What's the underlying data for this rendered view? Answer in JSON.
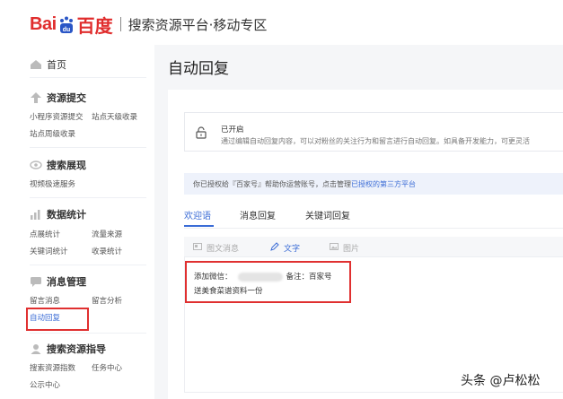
{
  "header": {
    "logo_bai": "Bai",
    "logo_paw": "du",
    "logo_du": "百度",
    "platform": "搜索资源平台·移动专区"
  },
  "sidebar": {
    "home": "首页",
    "groups": [
      {
        "title": "资源提交",
        "icon": "upload-icon",
        "links": [
          "小程序资源提交",
          "站点天级收录",
          "站点周级收录"
        ]
      },
      {
        "title": "搜索展现",
        "icon": "eye-icon",
        "links": [
          "视频极速服务"
        ]
      },
      {
        "title": "数据统计",
        "icon": "chart-icon",
        "links": [
          "点展统计",
          "流量来源",
          "关键词统计",
          "收录统计"
        ]
      },
      {
        "title": "消息管理",
        "icon": "message-icon",
        "links": [
          "留言消息",
          "留言分析",
          "自动回复"
        ]
      },
      {
        "title": "搜索资源指导",
        "icon": "user-icon",
        "links": [
          "搜索资源指数",
          "任务中心",
          "公示中心"
        ]
      }
    ]
  },
  "main": {
    "title": "自动回复",
    "notice": {
      "status": "已开启",
      "desc": "通过编辑自动回复内容，可以对粉丝的关注行为和留言进行自动回复。如具备开发能力，可更灵活"
    },
    "auth": {
      "text": "你已授权给『百家号』帮助你运营账号，点击管理",
      "link": "已授权的第三方平台"
    },
    "tabs": [
      "欢迎语",
      "消息回复",
      "关键词回复"
    ],
    "editor_tabs": [
      "图文消息",
      "文字",
      "图片"
    ],
    "editor": {
      "line1_prefix": "添加微信：",
      "line1_suffix": "备注：百家号",
      "line2": "送美食菜谱资料一份"
    }
  },
  "watermark": "头条 @卢松松",
  "colors": {
    "accent": "#3b6cd6",
    "brand_red": "#e02d2d",
    "highlight": "#e03030"
  }
}
